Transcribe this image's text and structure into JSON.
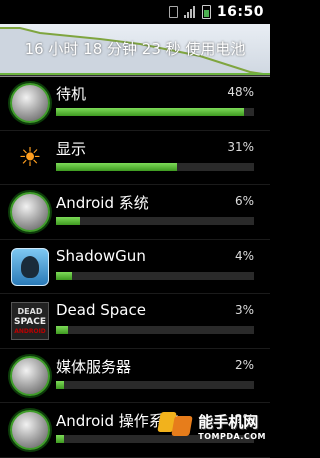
{
  "status_bar": {
    "time": "16:50",
    "icons": [
      "sim-card-icon",
      "signal-icon",
      "battery-icon"
    ]
  },
  "header": {
    "usage_text": "16 小时 18 分钟 23 秒 使用电池"
  },
  "items": [
    {
      "name": "待机",
      "percent": "48%",
      "fill": 0.95,
      "icon": "standby-signal-icon"
    },
    {
      "name": "显示",
      "percent": "31%",
      "fill": 0.61,
      "icon": "brightness-icon"
    },
    {
      "name": "Android 系统",
      "percent": "6%",
      "fill": 0.12,
      "icon": "android-system-icon"
    },
    {
      "name": "ShadowGun",
      "percent": "4%",
      "fill": 0.08,
      "icon": "shadowgun-app-icon"
    },
    {
      "name": "Dead Space",
      "percent": "3%",
      "fill": 0.06,
      "icon": "dead-space-app-icon"
    },
    {
      "name": "媒体服务器",
      "percent": "2%",
      "fill": 0.04,
      "icon": "media-server-icon"
    },
    {
      "name": "Android 操作系统",
      "percent": "2%",
      "fill": 0.04,
      "icon": "android-os-icon"
    }
  ],
  "icon_text": {
    "dead_space": [
      "DEAD",
      "SPACE",
      "ANDROID"
    ]
  },
  "watermark": {
    "cn": "能手机网",
    "en": "TOMPDA.COM"
  },
  "colors": {
    "accent_green": "#3e9a20",
    "background": "#000000",
    "sun_orange": "#ff9e1f"
  }
}
